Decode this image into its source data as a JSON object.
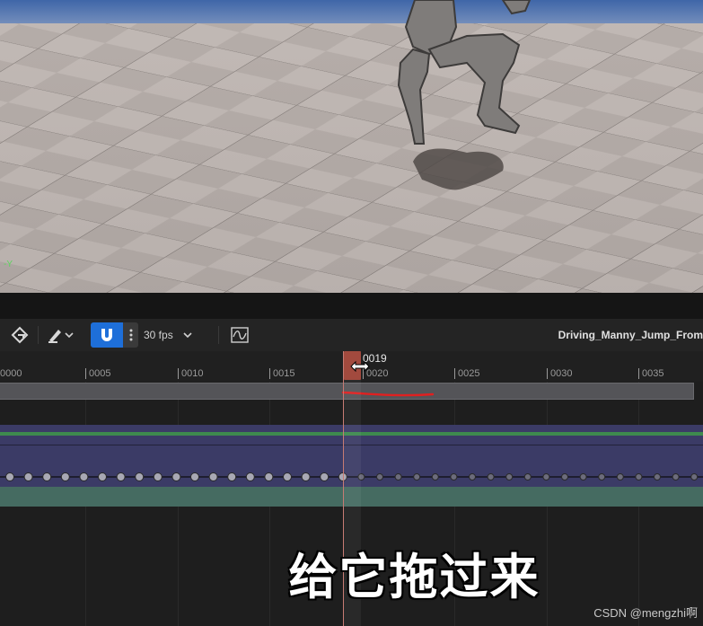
{
  "toolbar": {
    "fps_label": "30 fps",
    "sequence_title": "Driving_Manny_Jump_From"
  },
  "ruler": {
    "ticks": [
      "0000",
      "0005",
      "0010",
      "0015",
      "0020",
      "0025",
      "0030",
      "0035"
    ]
  },
  "playhead": {
    "frame": "0019"
  },
  "caption": {
    "text": "给它拖过来"
  },
  "watermark": {
    "text": "CSDN @mengzhi啊"
  },
  "colors": {
    "playhead": "#a24a3e",
    "snap_active": "#1e6fd9",
    "track_purple": "#3b3b66",
    "track_green": "#3e8a4e",
    "track_teal": "#456b61"
  },
  "icons": {
    "keyframe_tool": "key-icon",
    "paint_tool": "brush-icon",
    "snap": "magnet-icon",
    "more": "vertical-dots-icon",
    "dropdown": "chevron-down-icon",
    "curve_editor": "curve-graph-icon"
  }
}
